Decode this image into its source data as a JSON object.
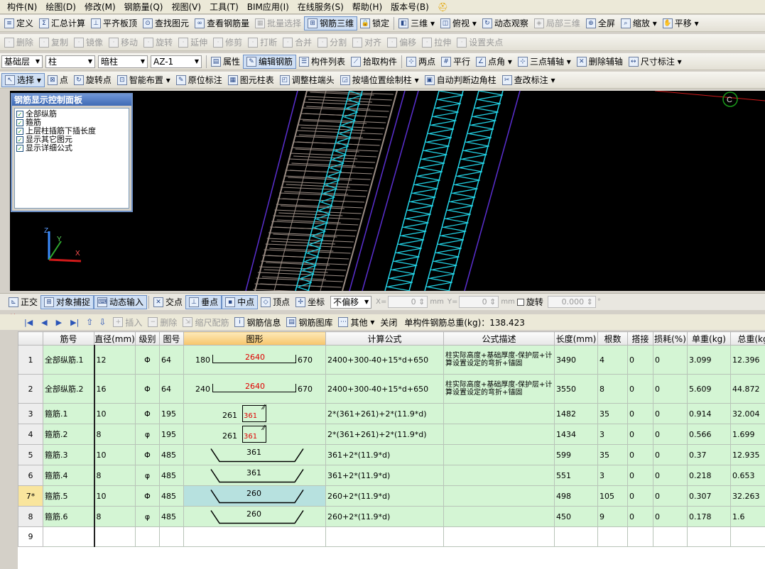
{
  "menu": [
    "构件(N)",
    "绘图(D)",
    "修改(M)",
    "钢筋量(Q)",
    "视图(V)",
    "工具(T)",
    "BIM应用(I)",
    "在线服务(S)",
    "帮助(H)",
    "版本号(B)"
  ],
  "toolbar1": {
    "items": [
      "定义",
      "汇总计算",
      "平齐板顶",
      "查找图元",
      "查看钢筋量",
      "批量选择",
      "钢筋三维",
      "锁定"
    ],
    "right": [
      "三维",
      "俯视",
      "动态观察",
      "局部三维",
      "全屏",
      "缩放",
      "平移"
    ]
  },
  "toolbar2": {
    "items": [
      "删除",
      "复制",
      "镜像",
      "移动",
      "旋转",
      "延伸",
      "修剪",
      "打断",
      "合并",
      "分割",
      "对齐",
      "偏移",
      "拉伸",
      "设置夹点"
    ]
  },
  "toolbar3": {
    "floor": "基础层",
    "type": "柱",
    "subtype": "暗柱",
    "member": "AZ-1",
    "items": [
      "属性",
      "编辑钢筋",
      "构件列表",
      "拾取构件",
      "两点",
      "平行",
      "点角",
      "三点辅轴",
      "删除辅轴",
      "尺寸标注"
    ]
  },
  "toolbar4": {
    "items": [
      "选择",
      "点",
      "旋转点",
      "智能布置",
      "原位标注",
      "图元柱表",
      "调整柱端头",
      "按墙位置绘制柱",
      "自动判断边角柱",
      "查改标注"
    ]
  },
  "rebar_panel": {
    "title": "钢筋显示控制面板",
    "options": [
      "全部纵筋",
      "箍筋",
      "上层柱插筋下插长度",
      "显示其它图元",
      "显示详细公式"
    ]
  },
  "viewport": {
    "axis_label": "C",
    "axes": [
      "Z",
      "Y",
      "X"
    ],
    "colors": {
      "gray": "#9b8d84",
      "cyan": "#22d3e6",
      "purple": "#5a2fd0",
      "red": "#d21a1a"
    }
  },
  "snapbar": {
    "items": [
      "正交",
      "对象捕捉",
      "动态输入",
      "交点",
      "垂点",
      "中点",
      "顶点",
      "坐标"
    ],
    "offset_mode": "不偏移",
    "x_label": "X=",
    "x_value": "0",
    "y_label": "Y=",
    "y_value": "0",
    "unit": "mm",
    "rotate_label": "旋转",
    "rotate_value": "0.000",
    "degree": "°"
  },
  "grid_toolbar": {
    "items": [
      "插入",
      "删除",
      "缩尺配筋",
      "钢筋信息",
      "钢筋图库",
      "其他",
      "关闭"
    ],
    "total_label": "单构件钢筋总重(kg)：138.423"
  },
  "table": {
    "headers": [
      "",
      "筋号",
      "直径(mm)",
      "级别",
      "图号",
      "图形",
      "计算公式",
      "公式描述",
      "长度(mm)",
      "根数",
      "搭接",
      "损耗(%)",
      "单重(kg)",
      "总重(kg"
    ],
    "rows": [
      {
        "no": "1",
        "name": "全部纵筋.1",
        "dia": "12",
        "grade": "Φ",
        "fig": "64",
        "shape": "L",
        "a": "180",
        "b": "2640",
        "c": "670",
        "formula": "2400+300-40+15*d+650",
        "desc": "柱实际高度+基础厚度-保护层+计算设置设定的弯折+锚固",
        "len": "3490",
        "count": "4",
        "lap": "0",
        "loss": "0",
        "unit": "3.099",
        "total": "12.396"
      },
      {
        "no": "2",
        "name": "全部纵筋.2",
        "dia": "16",
        "grade": "Φ",
        "fig": "64",
        "shape": "L",
        "a": "240",
        "b": "2640",
        "c": "670",
        "formula": "2400+300-40+15*d+650",
        "desc": "柱实际高度+基础厚度-保护层+计算设置设定的弯折+锚固",
        "len": "3550",
        "count": "8",
        "lap": "0",
        "loss": "0",
        "unit": "5.609",
        "total": "44.872"
      },
      {
        "no": "3",
        "name": "箍筋.1",
        "dia": "10",
        "grade": "Φ",
        "fig": "195",
        "shape": "S",
        "a": "261",
        "b": "361",
        "c": "",
        "formula": "2*(361+261)+2*(11.9*d)",
        "desc": "",
        "len": "1482",
        "count": "35",
        "lap": "0",
        "loss": "0",
        "unit": "0.914",
        "total": "32.004"
      },
      {
        "no": "4",
        "name": "箍筋.2",
        "dia": "8",
        "grade": "φ",
        "fig": "195",
        "shape": "S",
        "a": "261",
        "b": "361",
        "c": "",
        "formula": "2*(361+261)+2*(11.9*d)",
        "desc": "",
        "len": "1434",
        "count": "3",
        "lap": "0",
        "loss": "0",
        "unit": "0.566",
        "total": "1.699"
      },
      {
        "no": "5",
        "name": "箍筋.3",
        "dia": "10",
        "grade": "Φ",
        "fig": "485",
        "shape": "T",
        "a": "361",
        "b": "",
        "c": "",
        "formula": "361+2*(11.9*d)",
        "desc": "",
        "len": "599",
        "count": "35",
        "lap": "0",
        "loss": "0",
        "unit": "0.37",
        "total": "12.935"
      },
      {
        "no": "6",
        "name": "箍筋.4",
        "dia": "8",
        "grade": "φ",
        "fig": "485",
        "shape": "T",
        "a": "361",
        "b": "",
        "c": "",
        "formula": "361+2*(11.9*d)",
        "desc": "",
        "len": "551",
        "count": "3",
        "lap": "0",
        "loss": "0",
        "unit": "0.218",
        "total": "0.653"
      },
      {
        "no": "7*",
        "name": "箍筋.5",
        "dia": "10",
        "grade": "Φ",
        "fig": "485",
        "shape": "T",
        "a": "260",
        "b": "",
        "c": "",
        "formula": "260+2*(11.9*d)",
        "desc": "",
        "len": "498",
        "count": "105",
        "lap": "0",
        "loss": "0",
        "unit": "0.307",
        "total": "32.263"
      },
      {
        "no": "8",
        "name": "箍筋.6",
        "dia": "8",
        "grade": "φ",
        "fig": "485",
        "shape": "T",
        "a": "260",
        "b": "",
        "c": "",
        "formula": "260+2*(11.9*d)",
        "desc": "",
        "len": "450",
        "count": "9",
        "lap": "0",
        "loss": "0",
        "unit": "0.178",
        "total": "1.6"
      },
      {
        "no": "9",
        "name": "",
        "dia": "",
        "grade": "",
        "fig": "",
        "shape": "",
        "a": "",
        "b": "",
        "c": "",
        "formula": "",
        "desc": "",
        "len": "",
        "count": "",
        "lap": "",
        "loss": "",
        "unit": "",
        "total": ""
      }
    ]
  }
}
